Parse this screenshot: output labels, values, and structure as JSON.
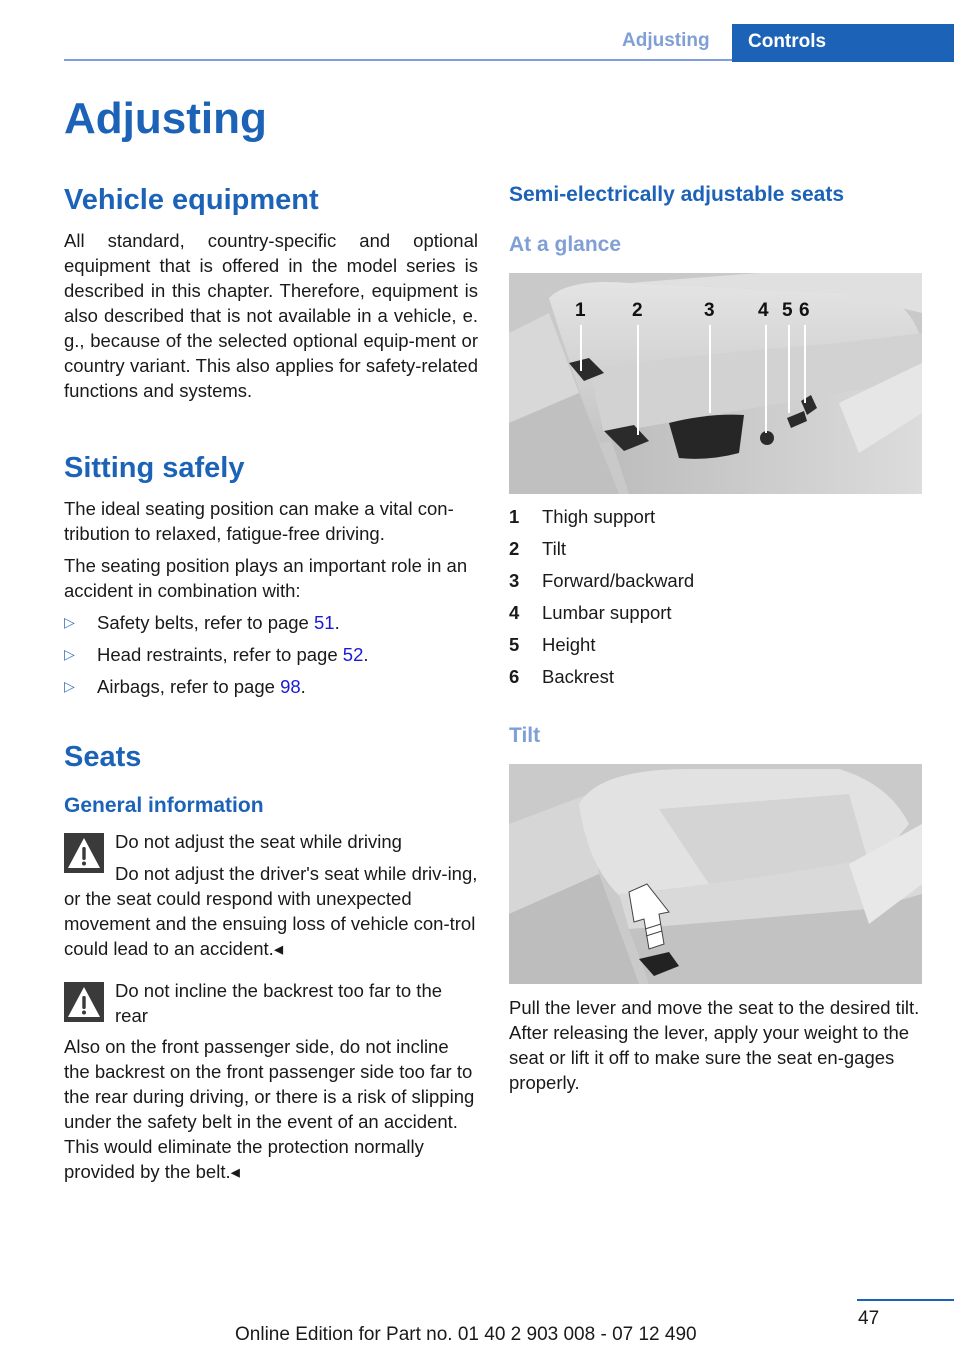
{
  "header": {
    "section_tab": "Adjusting",
    "chapter_tab": "Controls"
  },
  "page_title": "Adjusting",
  "left_column": {
    "vehicle_equipment": {
      "heading": "Vehicle equipment",
      "body": "All standard, country-specific and optional equipment that is offered in the model series is described in this chapter. Therefore, equipment is also described that is not available in a vehicle, e. g., because of the selected optional equip-ment or country variant. This also applies for safety-related functions and systems."
    },
    "sitting_safely": {
      "heading": "Sitting safely",
      "para1": "The ideal seating position can make a vital con-tribution to relaxed, fatigue-free driving.",
      "para2": "The seating position plays an important role in an accident in combination with:",
      "bullet_icon": "triangle-right-icon",
      "bullets": [
        {
          "text": "Safety belts, refer to page ",
          "page": "51",
          "suffix": "."
        },
        {
          "text": "Head restraints, refer to page ",
          "page": "52",
          "suffix": "."
        },
        {
          "text": "Airbags, refer to page ",
          "page": "98",
          "suffix": "."
        }
      ]
    },
    "seats": {
      "heading": "Seats",
      "general_information": {
        "heading": "General information",
        "warnings": [
          {
            "icon": "warning-triangle-icon",
            "title": "Do not adjust the seat while driving",
            "body": "Do not adjust the driver's seat while driv-ing, or the seat could respond with unexpected movement and the ensuing loss of vehicle con-trol could lead to an accident.",
            "end_mark": "◂"
          },
          {
            "icon": "warning-triangle-icon",
            "title": "Do not incline the backrest too far to the rear",
            "body": "Also on the front passenger side, do not incline the backrest on the front passenger side too far to the rear during driving, or there is a risk of slipping under the safety belt in the event of an accident. This would eliminate the protection normally provided by the belt.",
            "end_mark": "◂"
          }
        ]
      }
    }
  },
  "right_column": {
    "semi_electric": {
      "heading": "Semi-electrically adjustable seats",
      "at_a_glance": {
        "heading": "At a glance",
        "figure_callouts": [
          "1",
          "2",
          "3",
          "4",
          "5",
          "6"
        ],
        "legend": [
          {
            "num": "1",
            "label": "Thigh support"
          },
          {
            "num": "2",
            "label": "Tilt"
          },
          {
            "num": "3",
            "label": "Forward/backward"
          },
          {
            "num": "4",
            "label": "Lumbar support"
          },
          {
            "num": "5",
            "label": "Height"
          },
          {
            "num": "6",
            "label": "Backrest"
          }
        ]
      },
      "tilt": {
        "heading": "Tilt",
        "body": "Pull the lever and move the seat to the desired tilt. After releasing the lever, apply your weight to the seat or lift it off to make sure the seat en-gages properly."
      }
    }
  },
  "footer": {
    "page_number": "47",
    "edition": "Online Edition for Part no. 01 40 2 903 008 - 07 12 490"
  },
  "colors": {
    "primary_blue": "#1c63b7",
    "light_blue": "#7f9fd6",
    "link_blue": "#1a1ad6",
    "warning_bg": "#3a3a3a"
  }
}
